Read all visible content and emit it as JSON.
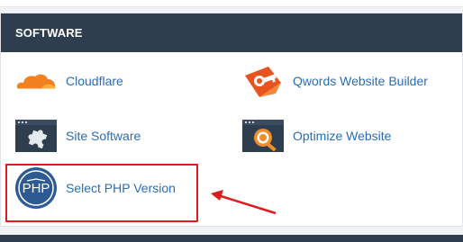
{
  "section": {
    "title": "SOFTWARE"
  },
  "items": [
    {
      "label": "Cloudflare",
      "icon": "cloudflare-icon"
    },
    {
      "label": "Qwords Website Builder",
      "icon": "website-builder-icon"
    },
    {
      "label": "Site Software",
      "icon": "site-software-icon"
    },
    {
      "label": "Optimize Website",
      "icon": "optimize-website-icon"
    },
    {
      "label": "Select PHP Version",
      "icon": "php-icon"
    }
  ],
  "php_badge_text": "PHP",
  "colors": {
    "header_bg": "#2f3e4f",
    "link": "#2a6db5",
    "highlight": "#e01b1b",
    "cloudflare_orange": "#f48120",
    "php_blue": "#2d5a93"
  }
}
